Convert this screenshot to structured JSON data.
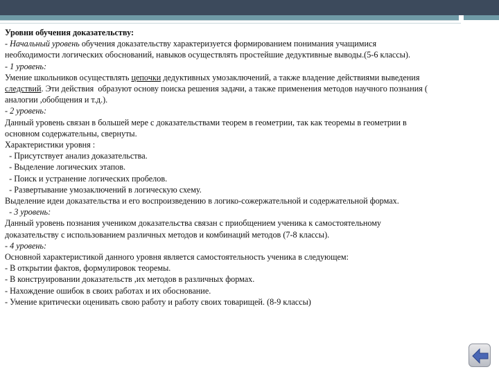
{
  "document": {
    "lines": [
      {
        "parts": [
          {
            "text": "Уровни обучения доказательству:",
            "style": "b"
          }
        ]
      },
      {
        "parts": [
          {
            "text": "- ",
            "style": ""
          },
          {
            "text": "Начальный уровень",
            "style": "i"
          },
          {
            "text": " обучения доказательству характеризуется формированием понимания учащимися",
            "style": ""
          }
        ]
      },
      {
        "parts": [
          {
            "text": "необходимости логических обоснований, навыков осуществлять простейшие дедуктивные выводы.(5-6 классы).",
            "style": ""
          }
        ]
      },
      {
        "parts": [
          {
            "text": "- 1 уровень:",
            "style": "i"
          }
        ]
      },
      {
        "parts": [
          {
            "text": "Умение школьников осуществлять ",
            "style": ""
          },
          {
            "text": "цепочки",
            "style": "u"
          },
          {
            "text": " дедуктивных умозаключений, а также владение действиями выведения",
            "style": ""
          }
        ]
      },
      {
        "parts": [
          {
            "text": "следствий",
            "style": "u"
          },
          {
            "text": ". Эти действия  образуют основу поиска решения задачи, а также применения методов научного познания (",
            "style": ""
          }
        ]
      },
      {
        "parts": [
          {
            "text": "аналогии ,обобщения и т.д.).",
            "style": ""
          }
        ]
      },
      {
        "parts": [
          {
            "text": "- 2 уровень:",
            "style": "i"
          }
        ]
      },
      {
        "parts": [
          {
            "text": "Данный уровень связан в большей мере с доказательствами теорем в геометрии, так как теоремы в геометрии в",
            "style": ""
          }
        ]
      },
      {
        "parts": [
          {
            "text": "основном содержательны, свернуты.",
            "style": ""
          }
        ]
      },
      {
        "parts": [
          {
            "text": "Характеристики уровня :",
            "style": ""
          }
        ]
      },
      {
        "parts": [
          {
            "text": "  - Присутствует анализ доказательства.",
            "style": ""
          }
        ]
      },
      {
        "parts": [
          {
            "text": "  - Выделение логических этапов.",
            "style": ""
          }
        ]
      },
      {
        "parts": [
          {
            "text": "  - Поиск и устранение логических пробелов.",
            "style": ""
          }
        ]
      },
      {
        "parts": [
          {
            "text": "  - Развертывание умозаключений в логическую схему.",
            "style": ""
          }
        ]
      },
      {
        "parts": [
          {
            "text": "Выделение идеи доказательства и его воспроизведению в логико-сожержательной и содержательной формах.",
            "style": ""
          }
        ]
      },
      {
        "parts": [
          {
            "text": "  - 3 уровень:",
            "style": "i"
          }
        ]
      },
      {
        "parts": [
          {
            "text": "Данный уровень познания учеником доказательства связан с приобщением ученика к самостоятельному",
            "style": ""
          }
        ]
      },
      {
        "parts": [
          {
            "text": "доказательству с использованием различных методов и комбинаций методов (7-8 классы).",
            "style": ""
          }
        ]
      },
      {
        "parts": [
          {
            "text": "- 4 уровень:",
            "style": "i"
          }
        ]
      },
      {
        "parts": [
          {
            "text": "Основной характеристикой данного уровня является самостоятельность ученика в следующем:",
            "style": ""
          }
        ]
      },
      {
        "parts": [
          {
            "text": "- В открытии фактов, формулировок теоремы.",
            "style": ""
          }
        ]
      },
      {
        "parts": [
          {
            "text": "- В конструировании доказательств ,их методов в различных формах.",
            "style": ""
          }
        ]
      },
      {
        "parts": [
          {
            "text": "- Нахождение ошибок в своих работах и их обоснование.",
            "style": ""
          }
        ]
      },
      {
        "parts": [
          {
            "text": "- Умение критически оценивать свою работу и работу своих товарищей. (8-9 классы)",
            "style": ""
          }
        ]
      }
    ]
  },
  "navigation": {
    "back_icon": "back-arrow-icon",
    "button_color": "#4a67b5"
  },
  "theme": {
    "topbar": "#3c4a5c",
    "accent": "#6f9aa6"
  }
}
